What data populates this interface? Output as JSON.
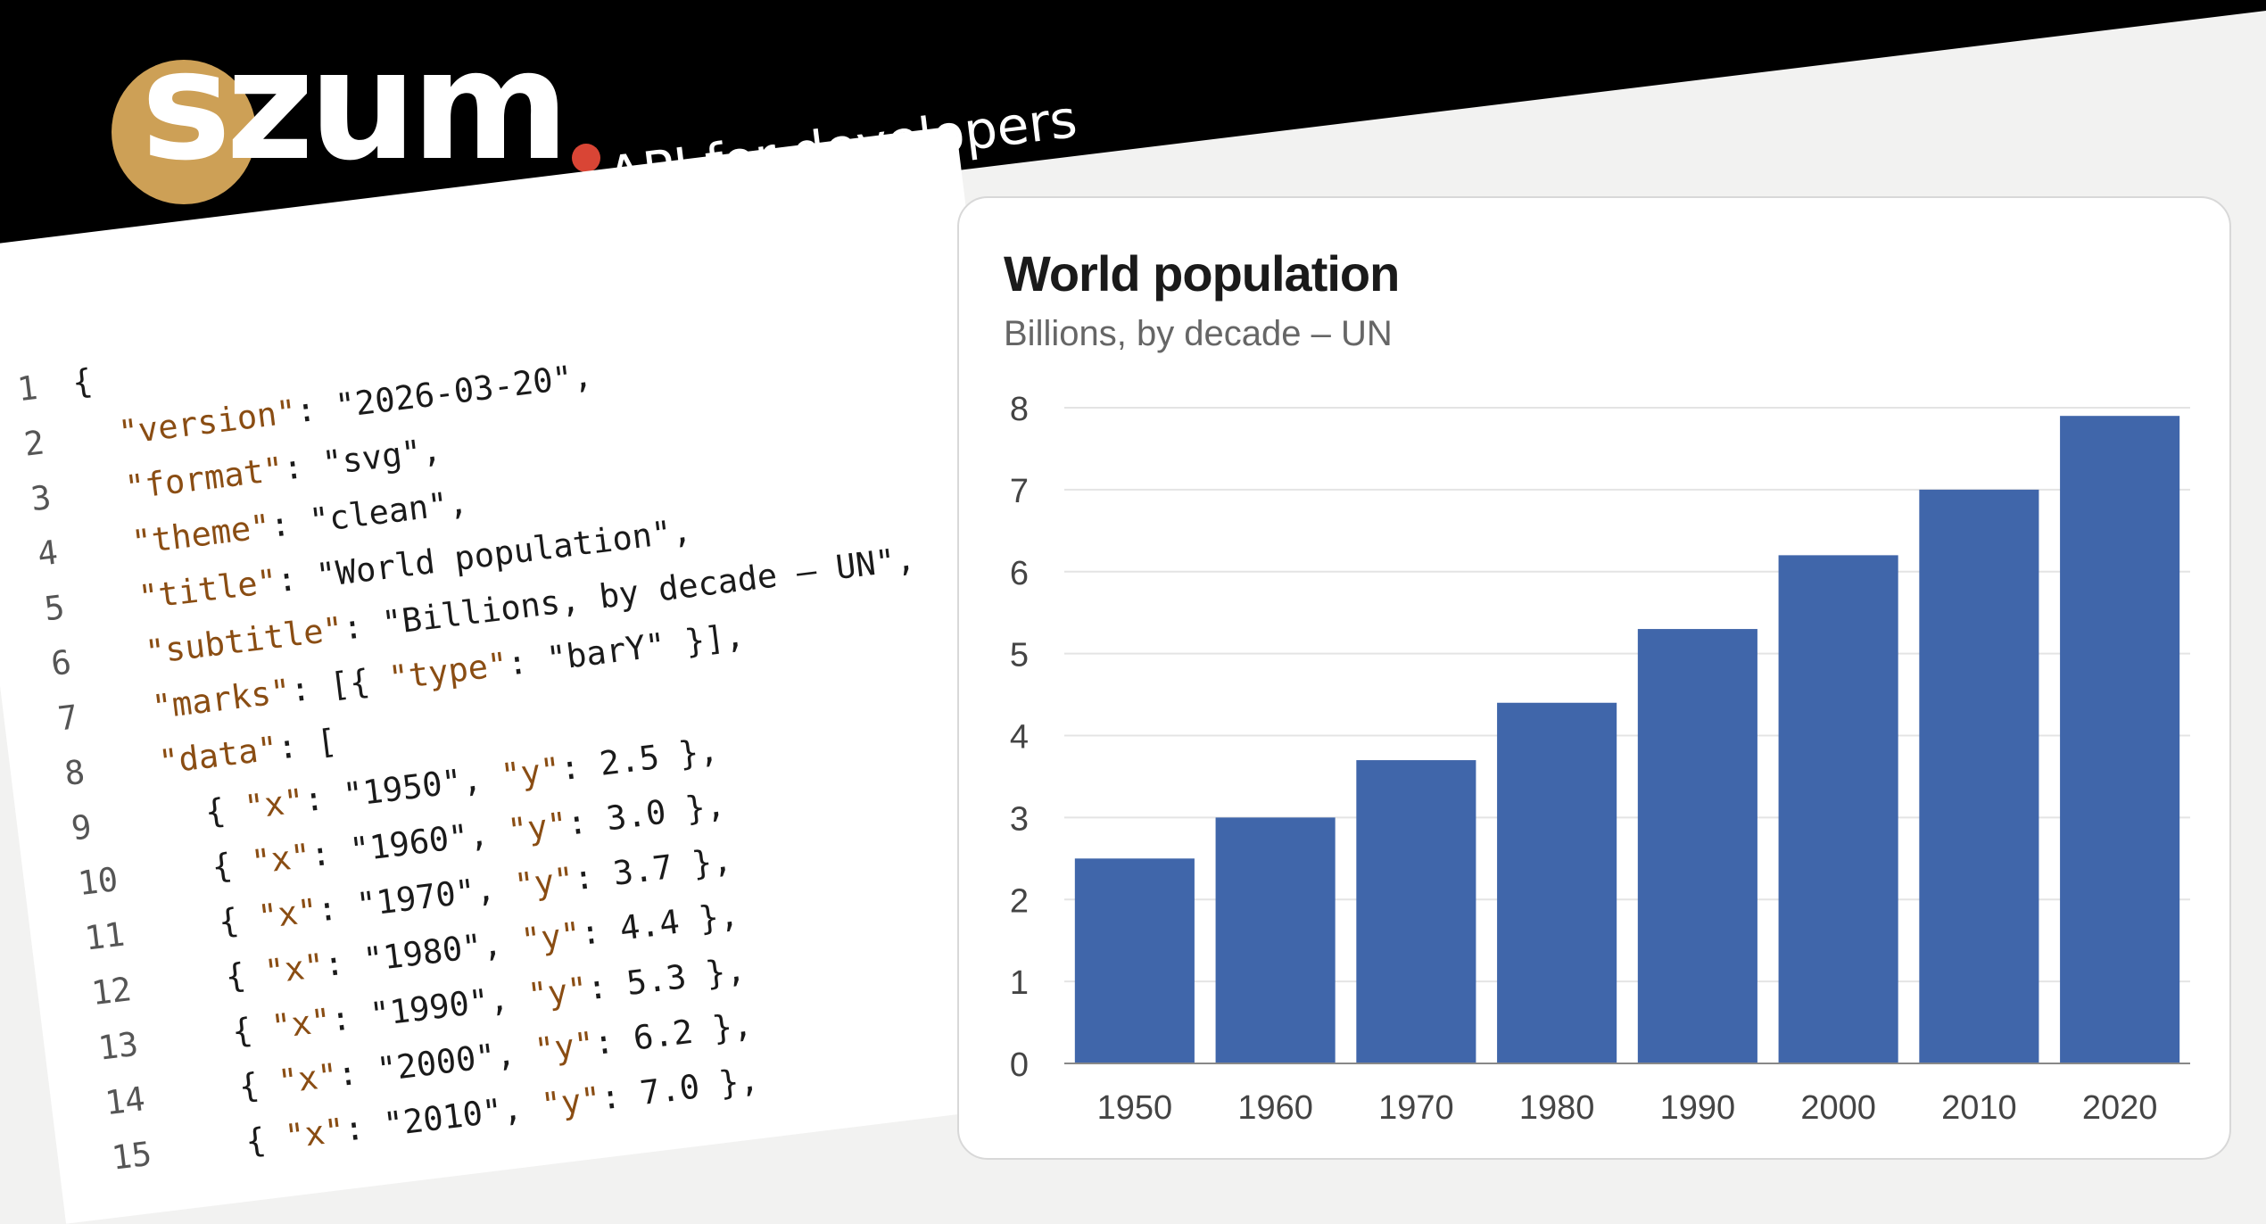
{
  "brand": {
    "logo_text": "szum",
    "tagline": "API for developers",
    "colors": {
      "badge": "#cda056",
      "dot": "#d94535"
    }
  },
  "code": {
    "lines": [
      {
        "num": "1",
        "parts": [
          {
            "t": "{",
            "c": "p"
          }
        ]
      },
      {
        "num": "2",
        "parts": [
          {
            "t": "  ",
            "c": "p"
          },
          {
            "t": "\"version\"",
            "c": "k"
          },
          {
            "t": ": \"2026-03-20\",",
            "c": "s"
          }
        ]
      },
      {
        "num": "3",
        "parts": [
          {
            "t": "  ",
            "c": "p"
          },
          {
            "t": "\"format\"",
            "c": "k"
          },
          {
            "t": ": \"svg\",",
            "c": "s"
          }
        ]
      },
      {
        "num": "4",
        "parts": [
          {
            "t": "  ",
            "c": "p"
          },
          {
            "t": "\"theme\"",
            "c": "k"
          },
          {
            "t": ": \"clean\",",
            "c": "s"
          }
        ]
      },
      {
        "num": "5",
        "parts": [
          {
            "t": "  ",
            "c": "p"
          },
          {
            "t": "\"title\"",
            "c": "k"
          },
          {
            "t": ": \"World population\",",
            "c": "s"
          }
        ]
      },
      {
        "num": "6",
        "parts": [
          {
            "t": "  ",
            "c": "p"
          },
          {
            "t": "\"subtitle\"",
            "c": "k"
          },
          {
            "t": ": \"Billions, by decade – UN\",",
            "c": "s"
          }
        ]
      },
      {
        "num": "7",
        "parts": [
          {
            "t": "  ",
            "c": "p"
          },
          {
            "t": "\"marks\"",
            "c": "k"
          },
          {
            "t": ": [{ ",
            "c": "s"
          },
          {
            "t": "\"type\"",
            "c": "k"
          },
          {
            "t": ": \"barY\" }],",
            "c": "s"
          }
        ]
      },
      {
        "num": "8",
        "parts": [
          {
            "t": "  ",
            "c": "p"
          },
          {
            "t": "\"data\"",
            "c": "k"
          },
          {
            "t": ": [",
            "c": "s"
          }
        ]
      },
      {
        "num": "9",
        "parts": [
          {
            "t": "    { ",
            "c": "s"
          },
          {
            "t": "\"x\"",
            "c": "k"
          },
          {
            "t": ": \"1950\", ",
            "c": "s"
          },
          {
            "t": "\"y\"",
            "c": "k"
          },
          {
            "t": ": 2.5 },",
            "c": "s"
          }
        ]
      },
      {
        "num": "10",
        "parts": [
          {
            "t": "    { ",
            "c": "s"
          },
          {
            "t": "\"x\"",
            "c": "k"
          },
          {
            "t": ": \"1960\", ",
            "c": "s"
          },
          {
            "t": "\"y\"",
            "c": "k"
          },
          {
            "t": ": 3.0 },",
            "c": "s"
          }
        ]
      },
      {
        "num": "11",
        "parts": [
          {
            "t": "    { ",
            "c": "s"
          },
          {
            "t": "\"x\"",
            "c": "k"
          },
          {
            "t": ": \"1970\", ",
            "c": "s"
          },
          {
            "t": "\"y\"",
            "c": "k"
          },
          {
            "t": ": 3.7 },",
            "c": "s"
          }
        ]
      },
      {
        "num": "12",
        "parts": [
          {
            "t": "    { ",
            "c": "s"
          },
          {
            "t": "\"x\"",
            "c": "k"
          },
          {
            "t": ": \"1980\", ",
            "c": "s"
          },
          {
            "t": "\"y\"",
            "c": "k"
          },
          {
            "t": ": 4.4 },",
            "c": "s"
          }
        ]
      },
      {
        "num": "13",
        "parts": [
          {
            "t": "    { ",
            "c": "s"
          },
          {
            "t": "\"x\"",
            "c": "k"
          },
          {
            "t": ": \"1990\", ",
            "c": "s"
          },
          {
            "t": "\"y\"",
            "c": "k"
          },
          {
            "t": ": 5.3 },",
            "c": "s"
          }
        ]
      },
      {
        "num": "14",
        "parts": [
          {
            "t": "    { ",
            "c": "s"
          },
          {
            "t": "\"x\"",
            "c": "k"
          },
          {
            "t": ": \"2000\", ",
            "c": "s"
          },
          {
            "t": "\"y\"",
            "c": "k"
          },
          {
            "t": ": 6.2 },",
            "c": "s"
          }
        ]
      },
      {
        "num": "15",
        "parts": [
          {
            "t": "    { ",
            "c": "s"
          },
          {
            "t": "\"x\"",
            "c": "k"
          },
          {
            "t": ": \"2010\", ",
            "c": "s"
          },
          {
            "t": "\"y\"",
            "c": "k"
          },
          {
            "t": ": 7.0 },",
            "c": "s"
          }
        ]
      }
    ]
  },
  "chart_data": {
    "type": "bar",
    "title": "World population",
    "subtitle": "Billions, by decade – UN",
    "categories": [
      "1950",
      "1960",
      "1970",
      "1980",
      "1990",
      "2000",
      "2010",
      "2020"
    ],
    "values": [
      2.5,
      3.0,
      3.7,
      4.4,
      5.3,
      6.2,
      7.0,
      7.9
    ],
    "yticks": [
      "0",
      "1",
      "2",
      "3",
      "4",
      "5",
      "6",
      "7",
      "8"
    ],
    "ylim": [
      0,
      8
    ],
    "grid": true,
    "bar_color": "#4066aa"
  }
}
